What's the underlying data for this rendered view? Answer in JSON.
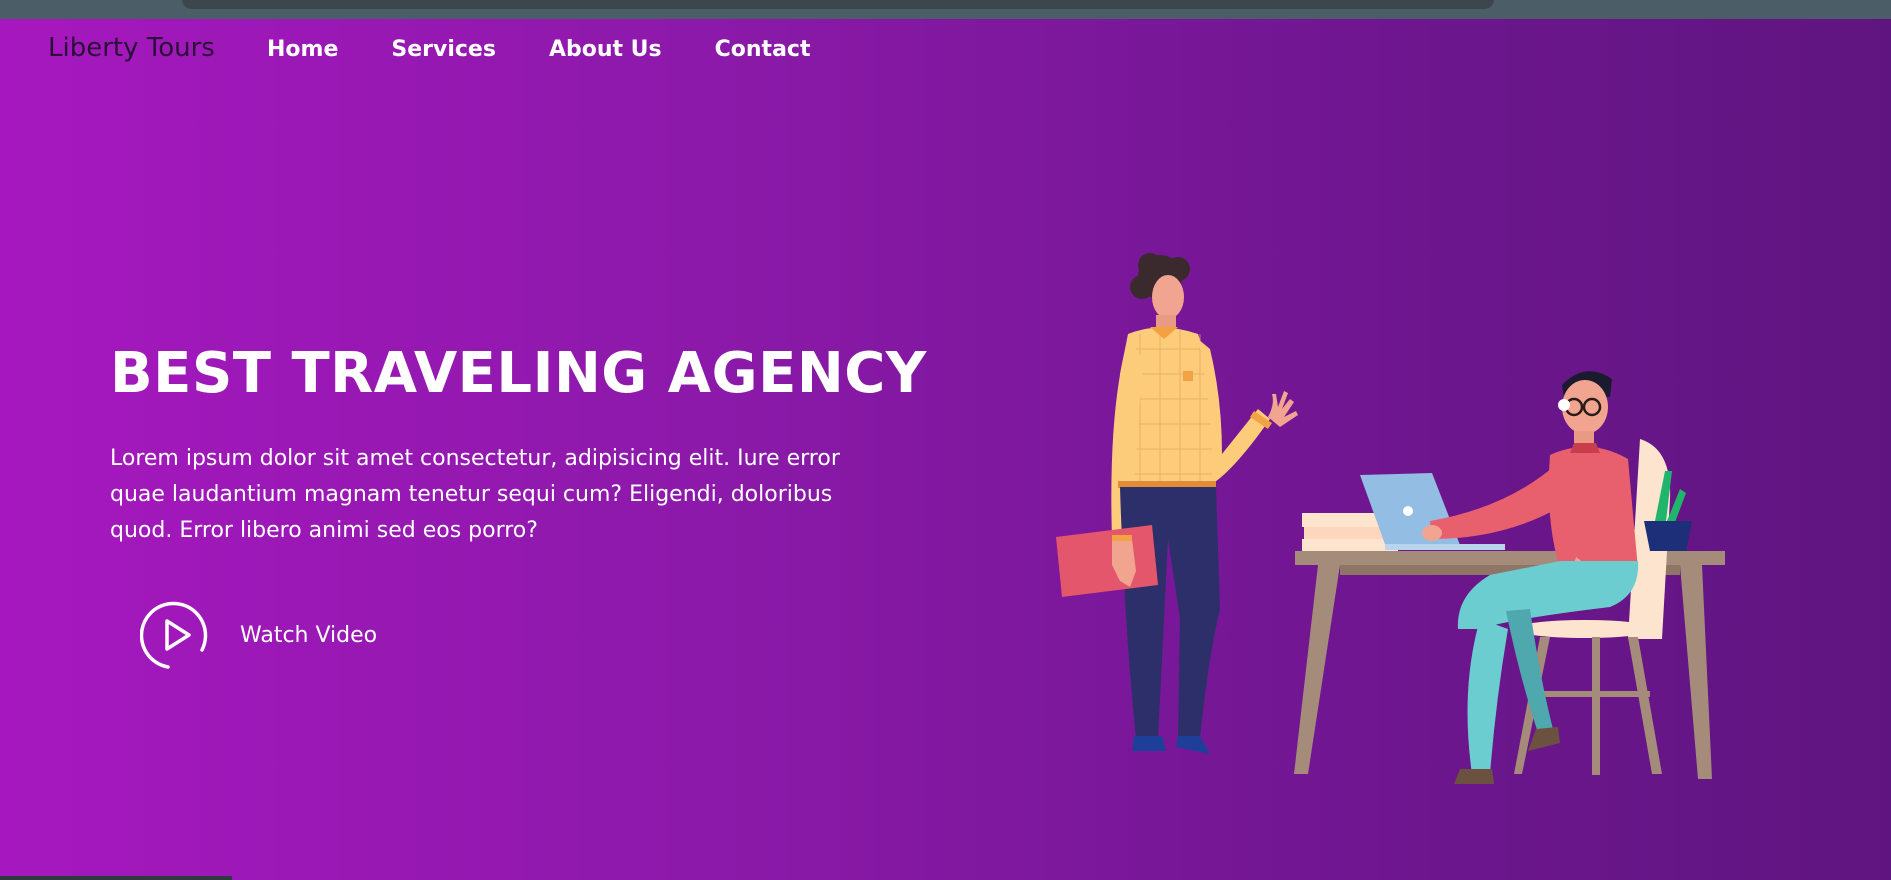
{
  "brand": {
    "name": "Liberty Tours"
  },
  "nav": {
    "items": [
      {
        "label": "Home"
      },
      {
        "label": "Services"
      },
      {
        "label": "About Us"
      },
      {
        "label": "Contact"
      }
    ]
  },
  "hero": {
    "title": "BEST TRAVELING AGENCY",
    "description": "Lorem ipsum dolor sit amet consectetur, adipisicing elit. Iure error quae laudantium magnam tenetur sequi cum? Eligendi, doloribus quod. Error libero animi sed eos porro?",
    "cta_label": "Watch Video",
    "cta_icon": "play-circle-icon"
  },
  "colors": {
    "gradient_start": "#a618bf",
    "gradient_end": "#5f1580",
    "text": "#ffffff",
    "brand_text": "#2a1036"
  },
  "illustration": {
    "subject": "office-meeting-illustration"
  }
}
